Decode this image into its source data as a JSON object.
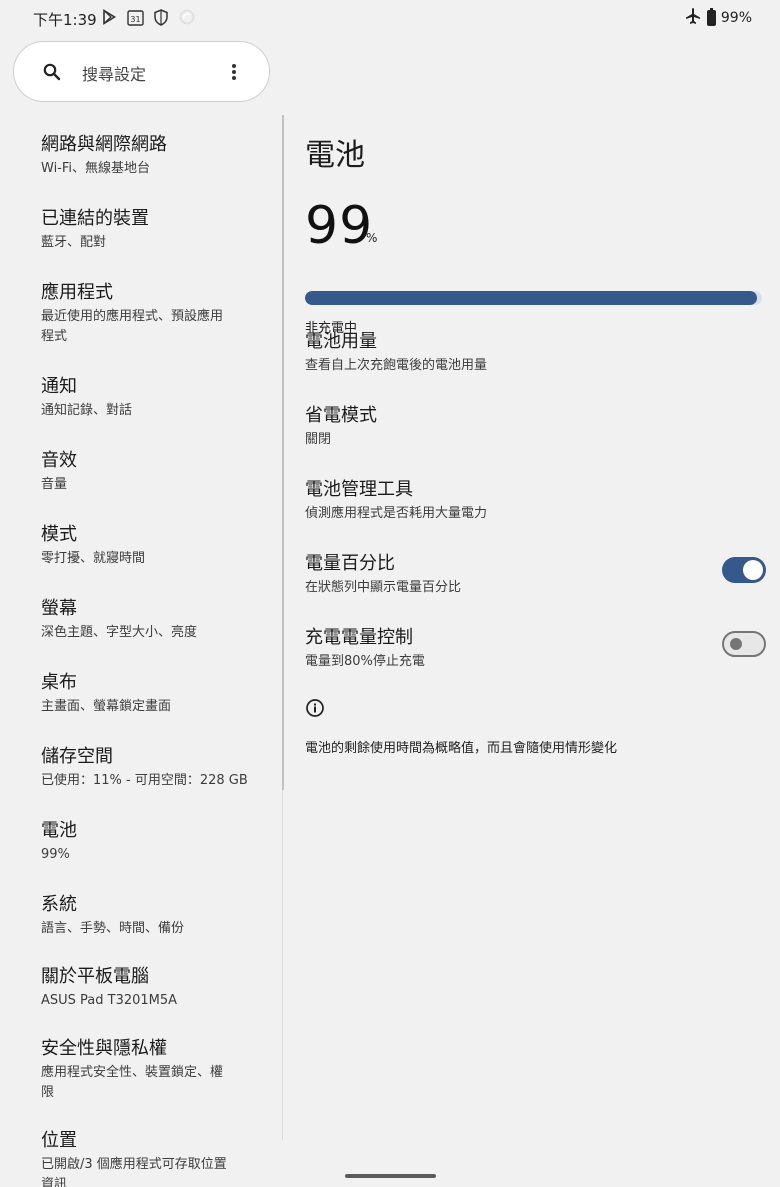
{
  "status_bar": {
    "time": "下午1:39",
    "left_icons": [
      "play-store-icon",
      "calendar-icon",
      "shield-icon",
      "sync-icon"
    ],
    "calendar_day": "31",
    "right_icons": [
      "airplane-mode-icon",
      "battery-icon"
    ],
    "battery_text": "99%"
  },
  "search": {
    "placeholder": "搜尋設定"
  },
  "sidebar": {
    "items": [
      {
        "title": "網路與網際網路",
        "subtitle": "Wi-Fi、無線基地台"
      },
      {
        "title": "已連結的裝置",
        "subtitle": "藍牙、配對"
      },
      {
        "title": "應用程式",
        "subtitle_line1": "最近使用的應用程式、預設應用",
        "subtitle_line2": "程式"
      },
      {
        "title": "通知",
        "subtitle": "通知記錄、對話"
      },
      {
        "title": "音效",
        "subtitle": "音量"
      },
      {
        "title": "模式",
        "subtitle": "零打擾、就寢時間"
      },
      {
        "title": "螢幕",
        "subtitle": "深色主題、字型大小、亮度"
      },
      {
        "title": "桌布",
        "subtitle": "主畫面、螢幕鎖定畫面"
      },
      {
        "title": "儲存空間",
        "subtitle": "已使用：11% - 可用空間：228 GB"
      },
      {
        "title": "電池",
        "subtitle": "99%",
        "active": true
      },
      {
        "title": "系統",
        "subtitle": "語言、手勢、時間、備份"
      },
      {
        "title": "關於平板電腦",
        "subtitle": "ASUS Pad T3201M5A"
      },
      {
        "title": "安全性與隱私權",
        "subtitle_line1": "應用程式安全性、裝置鎖定、權",
        "subtitle_line2": "限"
      },
      {
        "title": "位置",
        "subtitle_line1": "已開啟/3 個應用程式可存取位置",
        "subtitle_line2": "資訊"
      }
    ]
  },
  "battery_page": {
    "title": "電池",
    "level": "99",
    "level_unit": "%",
    "level_fraction": 0.99,
    "charge_status": "非充電中",
    "rows": [
      {
        "title": "電池用量",
        "subtitle": "查看自上次充飽電後的電池用量"
      },
      {
        "title": "省電模式",
        "subtitle": "關閉"
      },
      {
        "title": "電池管理工具",
        "subtitle": "偵測應用程式是否耗用大量電力"
      },
      {
        "title": "電量百分比",
        "subtitle": "在狀態列中顯示電量百分比",
        "toggle": "on"
      },
      {
        "title": "充電電量控制",
        "subtitle": "電量到80%停止充電",
        "toggle": "off"
      }
    ],
    "footer_note": "電池的剩餘使用時間為概略值，而且會隨使用情形變化"
  },
  "colors": {
    "accent": "#35598a",
    "background": "#f1f1f1",
    "active_item": "#e1e1e1"
  }
}
